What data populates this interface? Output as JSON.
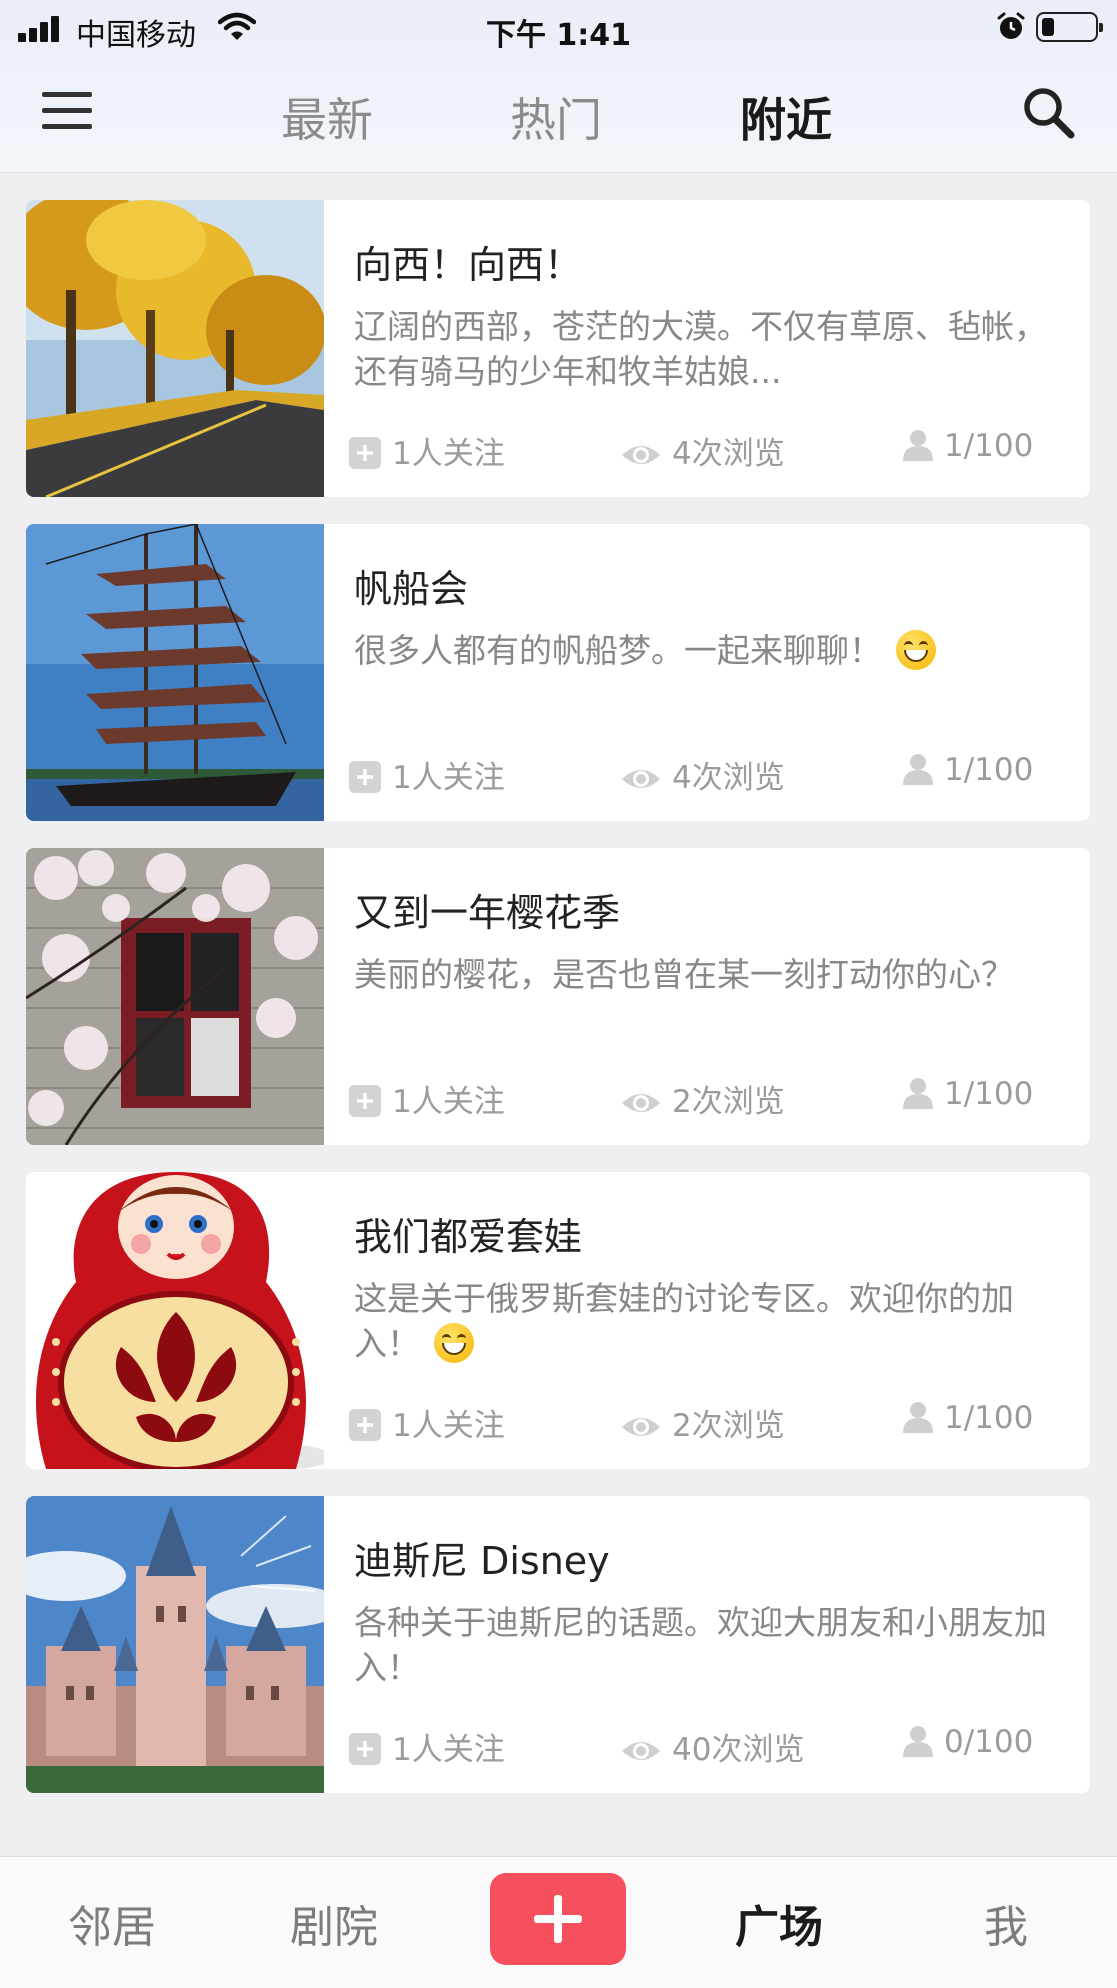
{
  "status_bar": {
    "carrier": "中国移动",
    "time": "下午 1:41"
  },
  "header": {
    "tabs": [
      {
        "label": "最新"
      },
      {
        "label": "热门"
      },
      {
        "label": "附近"
      }
    ],
    "active_tab": "附近"
  },
  "groups": [
    {
      "title": "向西！向西！",
      "description": "辽阔的西部，苍茫的大漠。不仅有草原、毡帐，还有骑马的少年和牧羊姑娘...",
      "follows": "1人关注",
      "views": "4次浏览",
      "capacity": "1/100",
      "image": "golden-trees-road"
    },
    {
      "title": "帆船会",
      "description": "很多人都有的帆船梦。一起来聊聊！",
      "emoji": "grinning-emoji",
      "follows": "1人关注",
      "views": "4次浏览",
      "capacity": "1/100",
      "image": "tall-ship"
    },
    {
      "title": "又到一年樱花季",
      "description": "美丽的樱花，是否也曾在某一刻打动你的心？",
      "follows": "1人关注",
      "views": "2次浏览",
      "capacity": "1/100",
      "image": "cherry-blossom-window"
    },
    {
      "title": "我们都爱套娃",
      "description": "这是关于俄罗斯套娃的讨论专区。欢迎你的加入！",
      "emoji": "grinning-emoji",
      "follows": "1人关注",
      "views": "2次浏览",
      "capacity": "1/100",
      "image": "matryoshka-doll"
    },
    {
      "title": "迪斯尼 Disney",
      "description": "各种关于迪斯尼的话题。欢迎大朋友和小朋友加入！",
      "follows": "1人关注",
      "views": "40次浏览",
      "capacity": "0/100",
      "image": "disney-castle"
    }
  ],
  "bottom_nav": {
    "items": [
      {
        "label": "邻居"
      },
      {
        "label": "剧院"
      },
      {
        "label": "广场"
      },
      {
        "label": "我"
      }
    ],
    "active": "广场"
  },
  "colors": {
    "accent": "#f6505f",
    "text": "#222222",
    "muted": "#888888"
  }
}
